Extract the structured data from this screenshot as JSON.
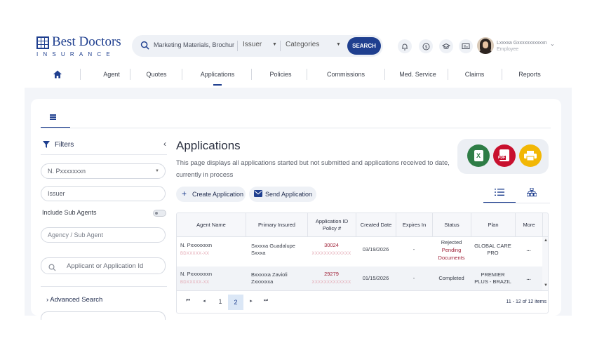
{
  "brand": {
    "name": "Best Doctors",
    "sub": "INSURANCE",
    "color": "#1f3f8f"
  },
  "search": {
    "query": "Marketing Materials, Brochur",
    "issuer_label": "Issuer",
    "categories_label": "Categories",
    "button": "SEARCH",
    "icon": "search-icon"
  },
  "topbar": {
    "icons": [
      "bell-icon",
      "dollar-icon",
      "graduation-cap-icon",
      "id-card-icon"
    ],
    "icon_glyphs": [
      "⍾",
      "$",
      "⌂",
      "⊡"
    ],
    "user_name": "Lxxxxa Gxxxxxxxxxxxn",
    "user_role": "Employee"
  },
  "nav": {
    "items": [
      "Agent",
      "Quotes",
      "Applications",
      "Policies",
      "Commissions",
      "Med. Service",
      "Claims",
      "Reports"
    ],
    "active": "Applications"
  },
  "filters": {
    "title": "Filters",
    "agent_value": "N. Pxxxxxxxn",
    "issuer_value": "Issuer",
    "include_sub_agents": "Include Sub Agents",
    "agency_placeholder": "Agency / Sub Agent",
    "applicant_placeholder": "Applicant or Application Id",
    "advanced_search": "Advanced Search"
  },
  "page": {
    "title": "Applications",
    "description": "This page displays all applications started but not submitted and applications received to date, currently in process",
    "create_button": "Create Application",
    "send_button": "Send Application",
    "exports": [
      {
        "label": "X",
        "icon": "excel-icon",
        "color": "#2e7d46"
      },
      {
        "label": "PDF",
        "icon": "pdf-icon",
        "color": "#c8102e"
      },
      {
        "label": "",
        "icon": "print-icon",
        "color": "#f2b705"
      }
    ]
  },
  "table": {
    "headers": [
      "Agent Name",
      "Primary Insured",
      "Application ID\nPolicy #",
      "Created Date",
      "Expires In",
      "Status",
      "Plan",
      "More"
    ],
    "rows": [
      {
        "agent": "N. Pxxxxxxxn",
        "agent_sub": "BDXXXXX-XX",
        "insured": "Sxxxxa Guadalupe Sxxxa",
        "app_id": "30024",
        "app_sub": "XXXXXXXXXXXXX",
        "created": "03/19/2026",
        "expires": "-",
        "status_lines": [
          "Rejected",
          "Pending",
          "Documents"
        ],
        "plan": "GLOBAL CARE PRO",
        "more": "..."
      },
      {
        "agent": "N. Pxxxxxxxn",
        "agent_sub": "BDXXXXX-XX",
        "insured": "Bxxxxxa Zavioli Zxxxxxxa",
        "app_id": "29279",
        "app_sub": "XXXXXXXXXXXXX",
        "created": "01/15/2026",
        "expires": "-",
        "status_lines": [
          "Completed"
        ],
        "plan": "PREMIER PLUS - BRAZIL",
        "more": "..."
      }
    ],
    "pager": {
      "first": "⏮",
      "prev": "◂",
      "pages": [
        "1",
        "2"
      ],
      "active_page": "2",
      "next": "▸",
      "last": "⏭",
      "count": "11 - 12 of 12 items"
    }
  }
}
